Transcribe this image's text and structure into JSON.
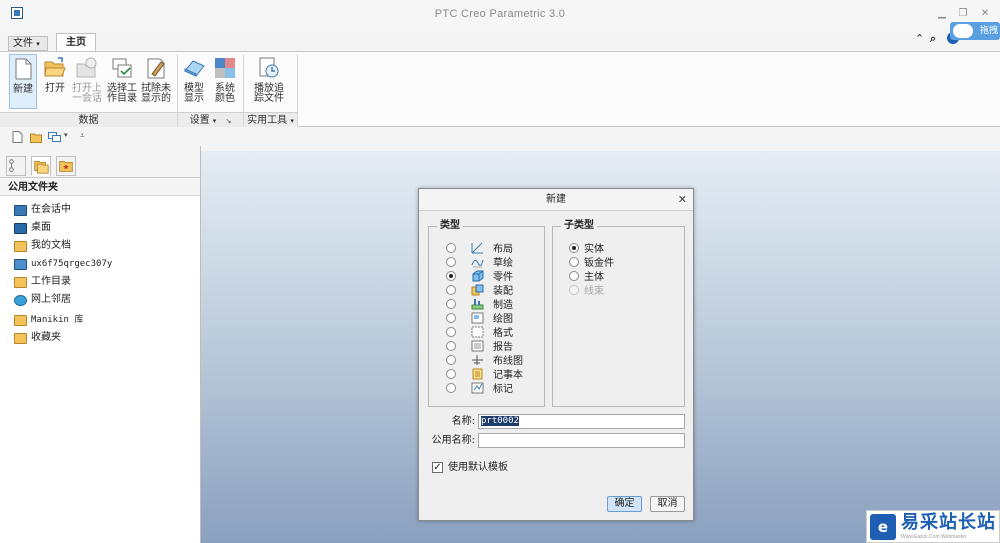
{
  "window": {
    "title": "PTC Creo Parametric 3.0",
    "minimize_icon": "minimize-icon",
    "restore_icon": "restore-icon",
    "close_icon": "close-icon"
  },
  "ribbon": {
    "tabs": [
      {
        "label": "文件",
        "dropdown": true
      },
      {
        "label": "主页",
        "active": true
      }
    ],
    "right_icons": [
      "collapse-ribbon-icon",
      "search-icon",
      "help-icon"
    ],
    "cloud_badge": "拖拽",
    "buttons": [
      {
        "label_line1": "新建",
        "label_line2": "",
        "icon": "new-file-icon",
        "enabled": true,
        "selected": true
      },
      {
        "label_line1": "打开",
        "label_line2": "",
        "icon": "open-folder-icon",
        "enabled": true
      },
      {
        "label_line1": "打开上",
        "label_line2": "一会话",
        "icon": "open-last-session-icon",
        "enabled": false
      },
      {
        "label_line1": "选择工",
        "label_line2": "作目录",
        "icon": "select-working-directory-icon",
        "enabled": true
      },
      {
        "label_line1": "拭除未",
        "label_line2": "显示的",
        "icon": "erase-not-displayed-icon",
        "enabled": true
      },
      {
        "label_line1": "模型",
        "label_line2": "显示",
        "icon": "model-display-icon",
        "enabled": true
      },
      {
        "label_line1": "系统",
        "label_line2": "颜色",
        "icon": "system-colors-icon",
        "enabled": true
      },
      {
        "label_line1": "播放追",
        "label_line2": "踪文件",
        "icon": "play-trail-file-icon",
        "enabled": true
      }
    ],
    "groups": [
      {
        "label": "数据"
      },
      {
        "label": "设置"
      },
      {
        "label": "实用工具"
      }
    ]
  },
  "quick_toolbar": {
    "icons": [
      "new-icon",
      "open-icon",
      "windows-icon",
      "customize-dropdown-icon"
    ]
  },
  "left_panel": {
    "tabs": [
      "model-tree-icon",
      "folder-browser-icon",
      "favorites-icon"
    ],
    "header": "公用文件夹",
    "items": [
      {
        "label": "在会话中",
        "icon": "in-session-icon",
        "mono": false
      },
      {
        "label": "桌面",
        "icon": "desktop-icon",
        "mono": false
      },
      {
        "label": "我的文档",
        "icon": "my-documents-icon",
        "mono": false
      },
      {
        "label": "ux6f75qrgec307y",
        "icon": "computer-icon",
        "mono": true
      },
      {
        "label": "工作目录",
        "icon": "working-directory-icon",
        "mono": false
      },
      {
        "label": "网上邻居",
        "icon": "network-icon",
        "mono": false
      },
      {
        "label": "Manikin 库",
        "icon": "manikin-library-icon",
        "mono": false
      },
      {
        "label": "收藏夹",
        "icon": "favorites-folder-icon",
        "mono": false
      }
    ]
  },
  "dialog": {
    "title": "新建",
    "type_group": {
      "legend": "类型",
      "options": [
        {
          "label": "布局",
          "icon": "layout-icon",
          "selected": false
        },
        {
          "label": "草绘",
          "icon": "sketch-icon",
          "selected": false
        },
        {
          "label": "零件",
          "icon": "part-icon",
          "selected": true
        },
        {
          "label": "装配",
          "icon": "assembly-icon",
          "selected": false
        },
        {
          "label": "制造",
          "icon": "manufacturing-icon",
          "selected": false
        },
        {
          "label": "绘图",
          "icon": "drawing-icon",
          "selected": false
        },
        {
          "label": "格式",
          "icon": "format-icon",
          "selected": false
        },
        {
          "label": "报告",
          "icon": "report-icon",
          "selected": false
        },
        {
          "label": "布线图",
          "icon": "diagram-icon",
          "selected": false
        },
        {
          "label": "记事本",
          "icon": "notebook-icon",
          "selected": false
        },
        {
          "label": "标记",
          "icon": "markup-icon",
          "selected": false
        }
      ]
    },
    "subtype_group": {
      "legend": "子类型",
      "options": [
        {
          "label": "实体",
          "selected": true,
          "disabled": false
        },
        {
          "label": "钣金件",
          "selected": false,
          "disabled": false
        },
        {
          "label": "主体",
          "selected": false,
          "disabled": false
        },
        {
          "label": "线束",
          "selected": false,
          "disabled": true
        }
      ]
    },
    "name_label": "名称:",
    "name_value": "prt0002",
    "common_name_label": "公用名称:",
    "common_name_value": "",
    "use_default_template_label": "使用默认模板",
    "use_default_template_checked": true,
    "ok_label": "确定",
    "cancel_label": "取消"
  },
  "watermark": {
    "logo": "e",
    "text": "易采站长站",
    "sub": "Www.Easck.Com Webmaster"
  },
  "colors": {
    "accent": "#1e5fb4",
    "graphics_top": "#e6eef5",
    "graphics_bottom": "#8aa0bf",
    "selected_text_bg": "#1e3c6a"
  }
}
